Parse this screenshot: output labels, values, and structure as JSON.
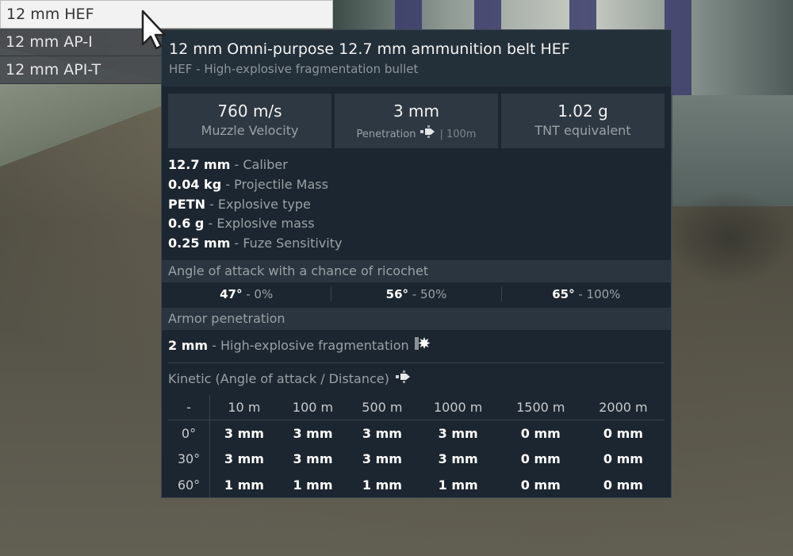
{
  "ammo_list": [
    {
      "label": "12 mm HEF",
      "selected": true
    },
    {
      "label": "12 mm AP-I",
      "selected": false
    },
    {
      "label": "12 mm API-T",
      "selected": false
    }
  ],
  "tooltip": {
    "title": "12 mm Omni-purpose 12.7 mm ammunition belt HEF",
    "subtitle": "HEF - High-explosive fragmentation bullet",
    "stats": {
      "velocity_value": "760 m/s",
      "velocity_label": "Muzzle Velocity",
      "penetration_value": "3 mm",
      "penetration_label": "Penetration",
      "penetration_range": "| 100m",
      "tnt_value": "1.02 g",
      "tnt_label": "TNT equivalent"
    },
    "properties": [
      {
        "value": "12.7 mm",
        "label": "- Caliber"
      },
      {
        "value": "0.04 kg",
        "label": "- Projectile Mass"
      },
      {
        "value": "PETN",
        "label": "- Explosive type"
      },
      {
        "value": "0.6 g",
        "label": "- Explosive mass"
      },
      {
        "value": "0.25 mm",
        "label": "- Fuze Sensitivity"
      }
    ],
    "ricochet": {
      "title": "Angle of attack with a chance of ricochet",
      "cells": [
        {
          "angle": "47°",
          "chance": "- 0%"
        },
        {
          "angle": "56°",
          "chance": "- 50%"
        },
        {
          "angle": "65°",
          "chance": "- 100%"
        }
      ]
    },
    "armor": {
      "title": "Armor penetration",
      "he_value": "2 mm",
      "he_label": "- High-explosive fragmentation",
      "kinetic_title": "Kinetic (Angle of attack / Distance)",
      "headers": [
        "-",
        "10 m",
        "100 m",
        "500 m",
        "1000 m",
        "1500 m",
        "2000 m"
      ],
      "rows": [
        [
          "0°",
          "3 mm",
          "3 mm",
          "3 mm",
          "3 mm",
          "0 mm",
          "0 mm"
        ],
        [
          "30°",
          "3 mm",
          "3 mm",
          "3 mm",
          "3 mm",
          "0 mm",
          "0 mm"
        ],
        [
          "60°",
          "1 mm",
          "1 mm",
          "1 mm",
          "1 mm",
          "0 mm",
          "0 mm"
        ]
      ]
    }
  },
  "icons": {
    "cursor": "arrow-cursor-icon",
    "penetration": "bullet-icon",
    "explosion": "explosion-icon"
  }
}
